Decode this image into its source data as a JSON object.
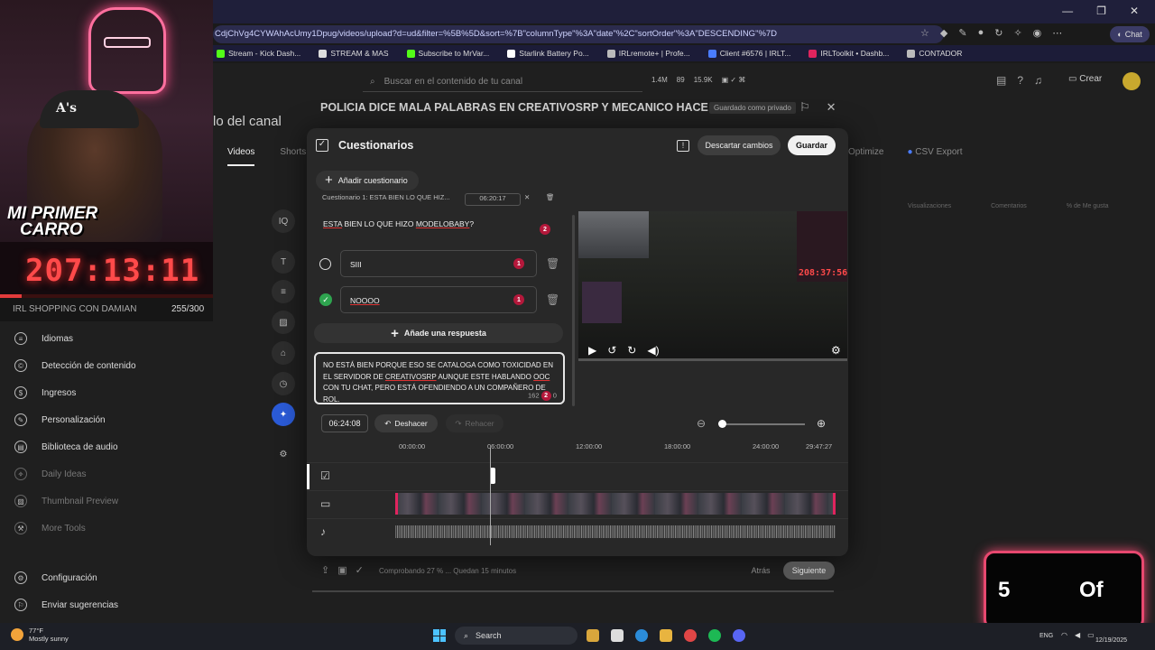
{
  "browser": {
    "url": "CdjChVg4CYWAhAcUmy1Dpug/videos/upload?d=ud&filter=%5B%5D&sort=%7B\"columnType\"%3A\"date\"%2C\"sortOrder\"%3A\"DESCENDING\"%7D",
    "chat_label": "Chat",
    "bookmarks": [
      {
        "label": "Stream - Kick Dash...",
        "color": "#53fc18"
      },
      {
        "label": "STREAM & MAS",
        "color": "#dddddd"
      },
      {
        "label": "Subscribe to MrVar...",
        "color": "#53fc18"
      },
      {
        "label": "Starlink Battery Po...",
        "color": "#ffffff"
      },
      {
        "label": "IRLremote+ | Profe...",
        "color": "#bbbbbb"
      },
      {
        "label": "Client #6576 | IRLT...",
        "color": "#4a7cff"
      },
      {
        "label": "IRLToolkit • Dashb...",
        "color": "#e0245e"
      },
      {
        "label": "CONTADOR",
        "color": "#bbbbbb"
      }
    ]
  },
  "studio": {
    "search_placeholder": "Buscar en el contenido de tu canal",
    "stats": [
      "1.4M",
      "89",
      "15.9K"
    ],
    "create_label": "Crear",
    "channel_title": "lo del canal",
    "tabs": [
      "Videos",
      "Shorts"
    ],
    "right_tabs": [
      "Optimize",
      "CSV Export"
    ],
    "column_heads": [
      "Visualizaciones",
      "Comentarios",
      "% de Me gusta"
    ],
    "sidebar": [
      {
        "label": "Idiomas",
        "icon": "language-icon",
        "dim": false
      },
      {
        "label": "Detección de contenido",
        "icon": "copyright-icon",
        "dim": false
      },
      {
        "label": "Ingresos",
        "icon": "dollar-icon",
        "dim": false
      },
      {
        "label": "Personalización",
        "icon": "brush-icon",
        "dim": false
      },
      {
        "label": "Biblioteca de audio",
        "icon": "audio-library-icon",
        "dim": false
      },
      {
        "label": "Daily Ideas",
        "icon": "bulb-icon",
        "dim": true
      },
      {
        "label": "Thumbnail Preview",
        "icon": "image-icon",
        "dim": true
      },
      {
        "label": "More Tools",
        "icon": "tools-icon",
        "dim": true
      },
      {
        "label": "Configuración",
        "icon": "gear-icon",
        "dim": false
      },
      {
        "label": "Enviar sugerencias",
        "icon": "feedback-icon",
        "dim": false
      }
    ]
  },
  "cam": {
    "cap_text": "A's",
    "headline_1": "MI PRIMER",
    "headline_2": "CARRO",
    "timer": "207:13:11",
    "progress": 0.1,
    "shop_label": "IRL SHOPPING CON DAMIAN",
    "count": "255/300"
  },
  "video": {
    "title": "POLICIA DICE MALA PALABRAS EN CREATIVOSRP Y MECANICO HACE R...",
    "saved_badge": "Guardado como privado"
  },
  "dialog": {
    "title": "Cuestionarios",
    "discard_label": "Descartar cambios",
    "save_label": "Guardar",
    "add_quiz_label": "Añadir cuestionario",
    "quiz_head_label": "Cuestionario 1: ESTA BIEN LO QUE HIZ...",
    "quiz_head_time": "06:20:17",
    "question_word1": "ESTA",
    "question_middle": " BIEN LO QUE HIZO ",
    "question_word2": "MODELOBABY",
    "question_end": "?",
    "question_badge": "2",
    "answers": [
      {
        "text": "SIII",
        "badge": "1",
        "correct": false
      },
      {
        "text": "NOOOO",
        "badge": "1",
        "correct": true
      }
    ],
    "add_answer_label": "Añade una respuesta",
    "explanation_p1": "NO ESTÁ BIEN PORQUE ESO SE CATALOGA COMO TOXICIDAD EN EL SERVIDOR DE ",
    "explanation_w1": "CREATIVOSRP",
    "explanation_p2": " AUNQUE ESTE HABLANDO ",
    "explanation_w2": "OOC",
    "explanation_p3": " CON TU CHAT, PERO ESTÁ OFENDIENDO A UN COMPAÑERO DE ROL.",
    "explanation_badge": "2",
    "explanation_count_a": "162",
    "explanation_count_b": "0",
    "preview_timer": "208:37:56",
    "time_value": "06:24:08",
    "undo_label": "Deshacer",
    "redo_label": "Rehacer",
    "ticks": [
      "00:00:00",
      "06:00:00",
      "12:00:00",
      "18:00:00",
      "24:00:00",
      "29:47:27"
    ],
    "footer_status": "Comprobando 27 % ... Quedan 15 minutos",
    "back_label": "Atrás",
    "next_label": "Siguiente"
  },
  "counter": {
    "a": "5",
    "b": "Of"
  },
  "taskbar": {
    "temp": "77°F",
    "weather": "Mostly sunny",
    "search_label": "Search",
    "lang": "ENG",
    "date": "12/19/2025"
  }
}
